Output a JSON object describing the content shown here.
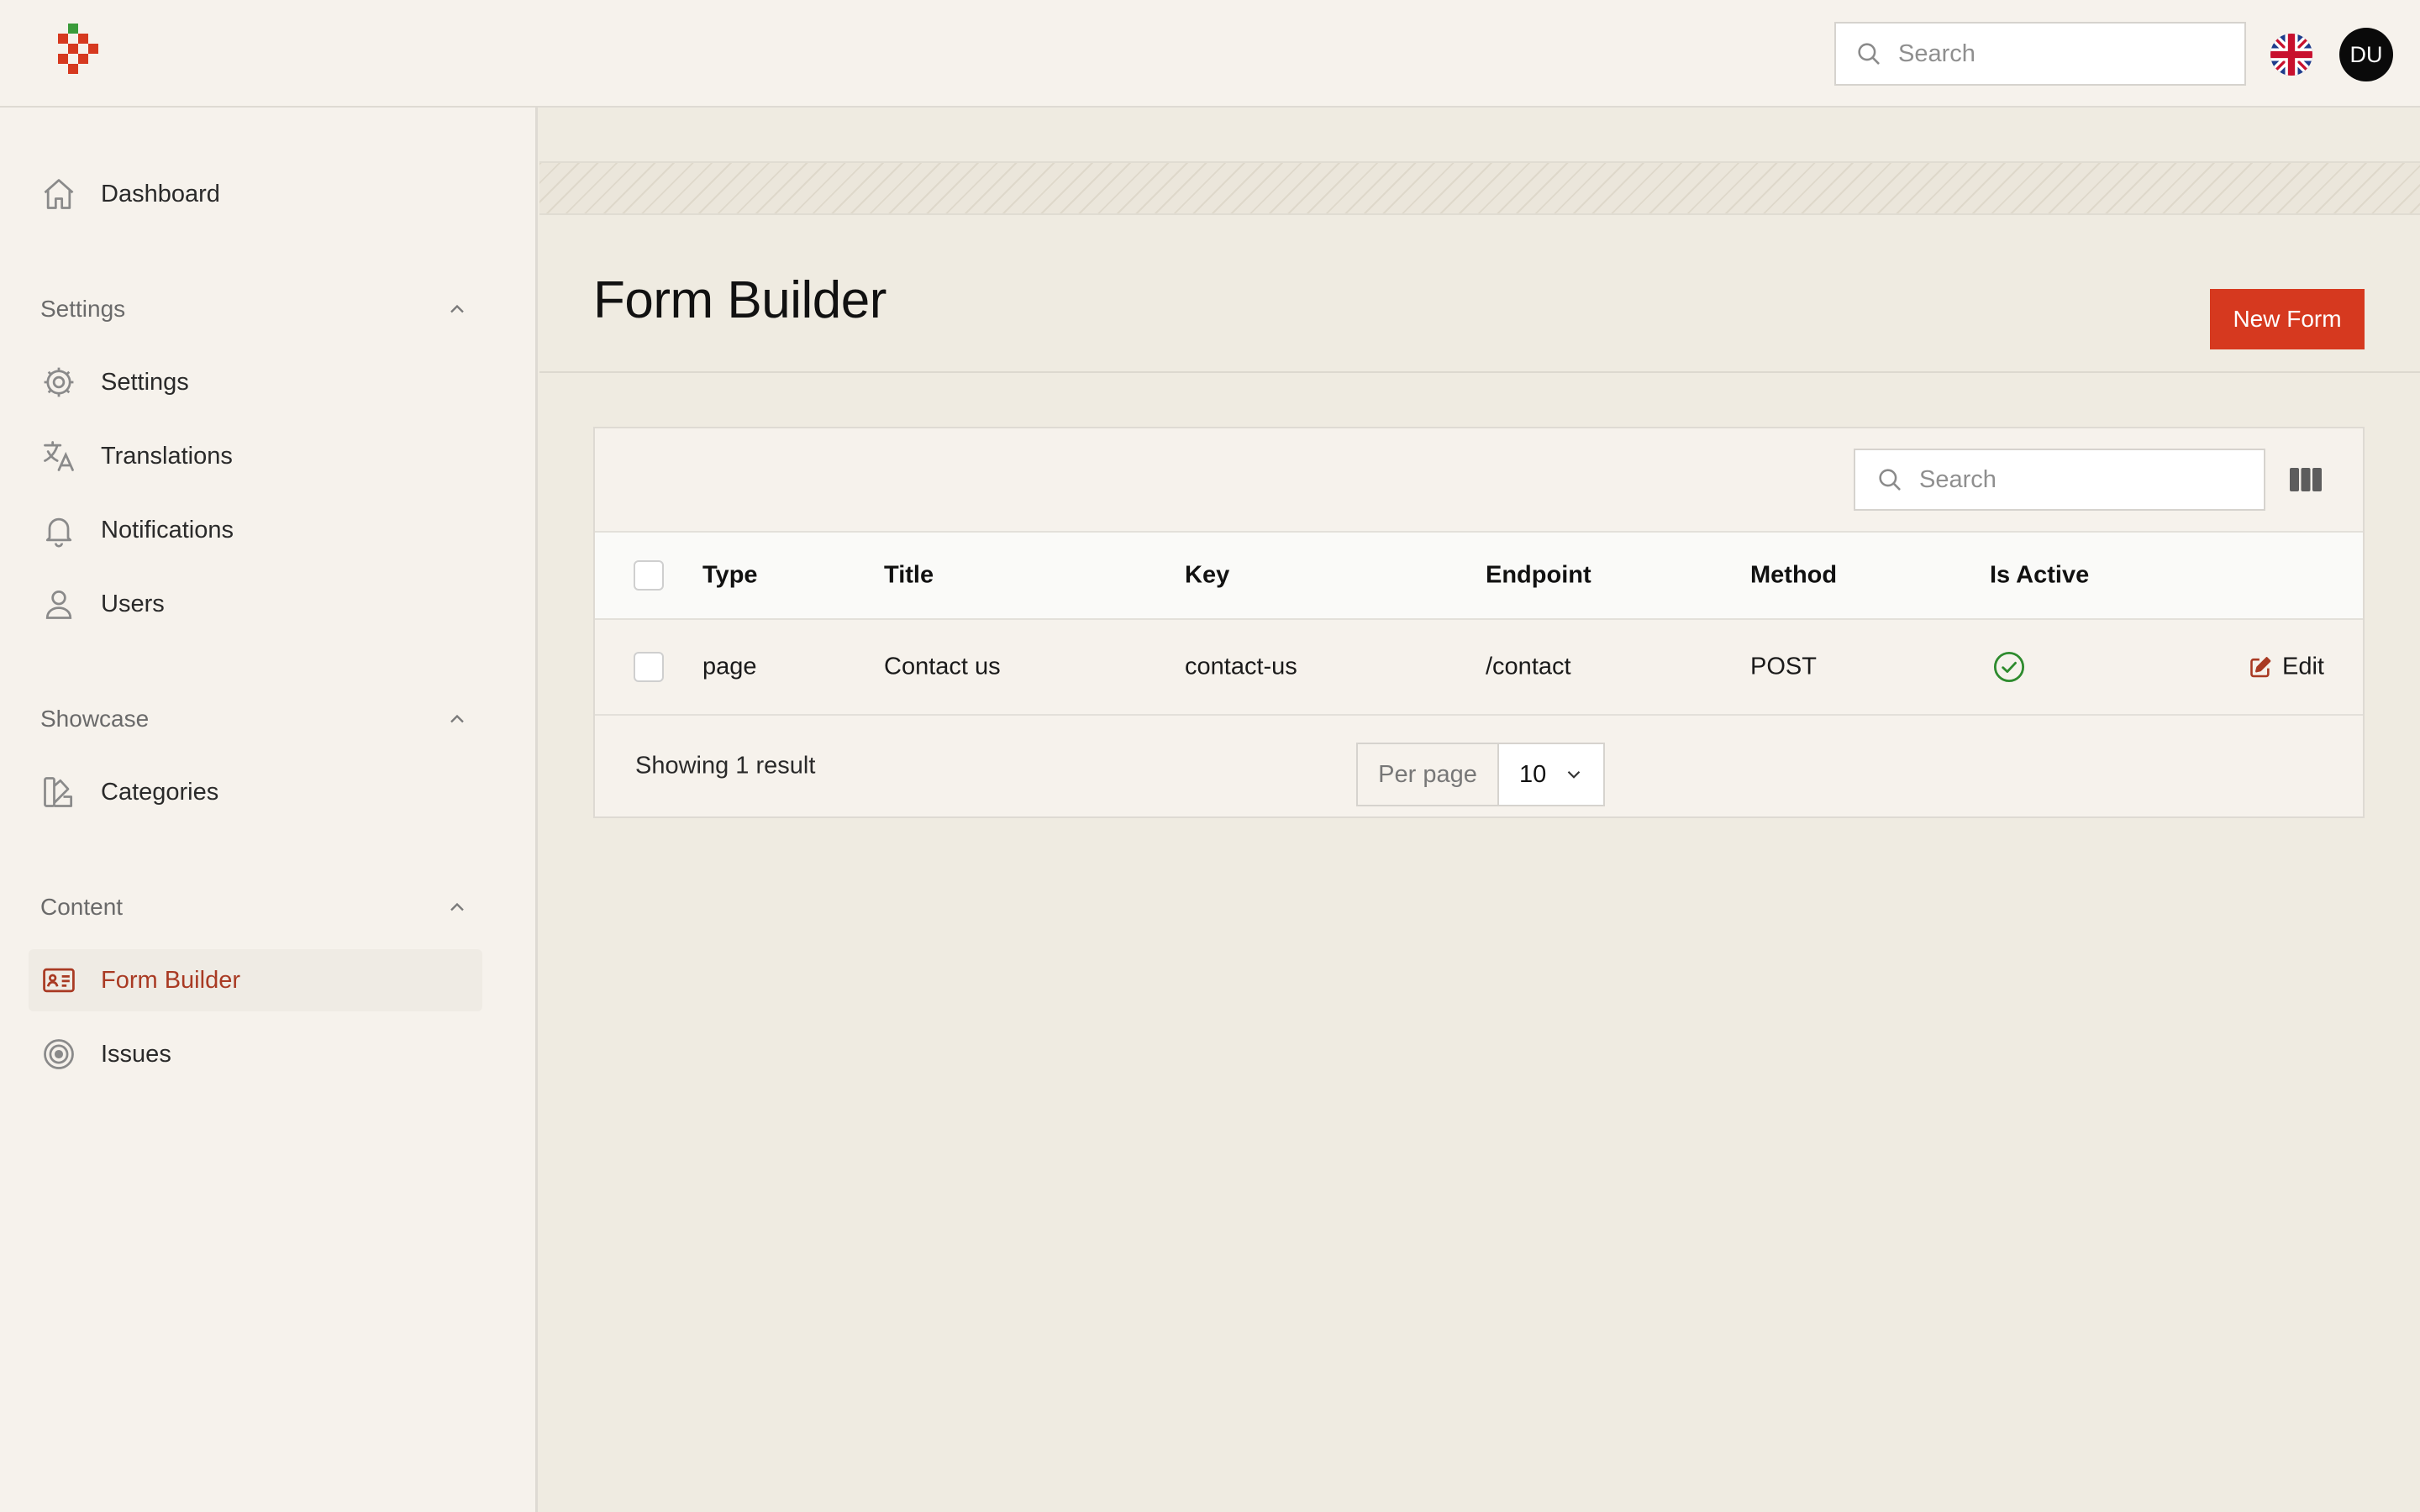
{
  "header": {
    "search_placeholder": "Search",
    "avatar_initials": "DU",
    "language_icon": "uk-flag-icon"
  },
  "sidebar": {
    "dashboard": {
      "label": "Dashboard",
      "icon": "home-icon"
    },
    "sections": [
      {
        "title": "Settings",
        "items": [
          {
            "label": "Settings",
            "icon": "cog-icon"
          },
          {
            "label": "Translations",
            "icon": "translate-icon"
          },
          {
            "label": "Notifications",
            "icon": "bell-icon"
          },
          {
            "label": "Users",
            "icon": "user-icon"
          }
        ]
      },
      {
        "title": "Showcase",
        "items": [
          {
            "label": "Categories",
            "icon": "swatch-icon"
          }
        ]
      },
      {
        "title": "Content",
        "items": [
          {
            "label": "Form Builder",
            "icon": "id-card-icon",
            "active": true
          },
          {
            "label": "Issues",
            "icon": "target-icon"
          }
        ]
      }
    ]
  },
  "page": {
    "title": "Form Builder",
    "new_button": "New Form"
  },
  "table": {
    "search_placeholder": "Search",
    "columns": [
      "Type",
      "Title",
      "Key",
      "Endpoint",
      "Method",
      "Is Active"
    ],
    "rows": [
      {
        "type": "page",
        "title": "Contact us",
        "key": "contact-us",
        "endpoint": "/contact",
        "method": "POST",
        "is_active": true,
        "action": "Edit"
      }
    ],
    "footer": {
      "showing": "Showing 1 result",
      "per_page_label": "Per page",
      "per_page_value": "10"
    }
  },
  "colors": {
    "accent": "#d6391f",
    "active_nav": "#a93a23",
    "success": "#2e8b2e"
  }
}
